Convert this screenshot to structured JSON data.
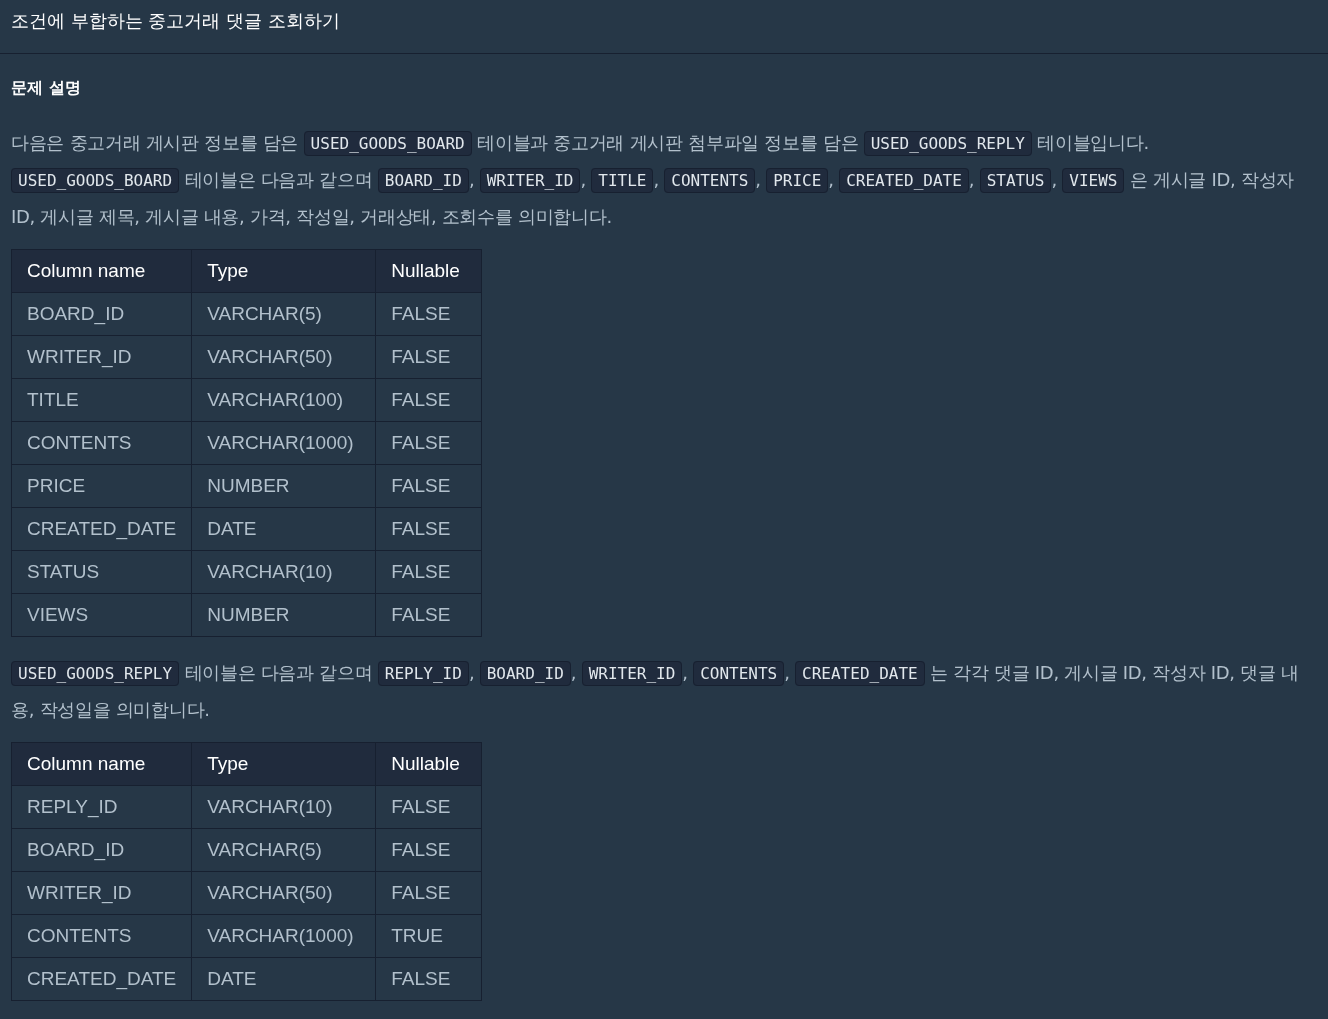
{
  "title": "조건에 부합하는 중고거래 댓글 조회하기",
  "section_heading": "문제 설명",
  "paragraphs": [
    [
      {
        "kind": "text",
        "text": "다음은 중고거래 게시판 정보를 담은 "
      },
      {
        "kind": "code",
        "text": "USED_GOODS_BOARD"
      },
      {
        "kind": "text",
        "text": " 테이블과 중고거래 게시판 첨부파일 정보를 담은 "
      },
      {
        "kind": "code",
        "text": "USED_GOODS_REPLY"
      },
      {
        "kind": "text",
        "text": " 테이블입니다. "
      },
      {
        "kind": "code",
        "text": "USED_GOODS_BOARD"
      },
      {
        "kind": "text",
        "text": " 테이블은 다음과 같으며 "
      },
      {
        "kind": "code",
        "text": "BOARD_ID"
      },
      {
        "kind": "text",
        "text": ", "
      },
      {
        "kind": "code",
        "text": "WRITER_ID"
      },
      {
        "kind": "text",
        "text": ", "
      },
      {
        "kind": "code",
        "text": "TITLE"
      },
      {
        "kind": "text",
        "text": ", "
      },
      {
        "kind": "code",
        "text": "CONTENTS"
      },
      {
        "kind": "text",
        "text": ", "
      },
      {
        "kind": "code",
        "text": "PRICE"
      },
      {
        "kind": "text",
        "text": ", "
      },
      {
        "kind": "code",
        "text": "CREATED_DATE"
      },
      {
        "kind": "text",
        "text": ", "
      },
      {
        "kind": "code",
        "text": "STATUS"
      },
      {
        "kind": "text",
        "text": ", "
      },
      {
        "kind": "code",
        "text": "VIEWS"
      },
      {
        "kind": "text",
        "text": " 은 게시글 ID, 작성자 ID, 게시글 제목, 게시글 내용, 가격, 작성일, 거래상태, 조회수를 의미합니다."
      }
    ],
    [
      {
        "kind": "code",
        "text": "USED_GOODS_REPLY"
      },
      {
        "kind": "text",
        "text": " 테이블은 다음과 같으며 "
      },
      {
        "kind": "code",
        "text": "REPLY_ID"
      },
      {
        "kind": "text",
        "text": ", "
      },
      {
        "kind": "code",
        "text": "BOARD_ID"
      },
      {
        "kind": "text",
        "text": ", "
      },
      {
        "kind": "code",
        "text": "WRITER_ID"
      },
      {
        "kind": "text",
        "text": ", "
      },
      {
        "kind": "code",
        "text": "CONTENTS"
      },
      {
        "kind": "text",
        "text": ", "
      },
      {
        "kind": "code",
        "text": "CREATED_DATE"
      },
      {
        "kind": "text",
        "text": " 는 각각 댓글 ID, 게시글 ID, 작성자 ID, 댓글 내용, 작성일을 의미합니다."
      }
    ]
  ],
  "tables": [
    {
      "columns": [
        "Column name",
        "Type",
        "Nullable"
      ],
      "rows": [
        [
          "BOARD_ID",
          "VARCHAR(5)",
          "FALSE"
        ],
        [
          "WRITER_ID",
          "VARCHAR(50)",
          "FALSE"
        ],
        [
          "TITLE",
          "VARCHAR(100)",
          "FALSE"
        ],
        [
          "CONTENTS",
          "VARCHAR(1000)",
          "FALSE"
        ],
        [
          "PRICE",
          "NUMBER",
          "FALSE"
        ],
        [
          "CREATED_DATE",
          "DATE",
          "FALSE"
        ],
        [
          "STATUS",
          "VARCHAR(10)",
          "FALSE"
        ],
        [
          "VIEWS",
          "NUMBER",
          "FALSE"
        ]
      ]
    },
    {
      "columns": [
        "Column name",
        "Type",
        "Nullable"
      ],
      "rows": [
        [
          "REPLY_ID",
          "VARCHAR(10)",
          "FALSE"
        ],
        [
          "BOARD_ID",
          "VARCHAR(5)",
          "FALSE"
        ],
        [
          "WRITER_ID",
          "VARCHAR(50)",
          "FALSE"
        ],
        [
          "CONTENTS",
          "VARCHAR(1000)",
          "TRUE"
        ],
        [
          "CREATED_DATE",
          "DATE",
          "FALSE"
        ]
      ]
    }
  ]
}
